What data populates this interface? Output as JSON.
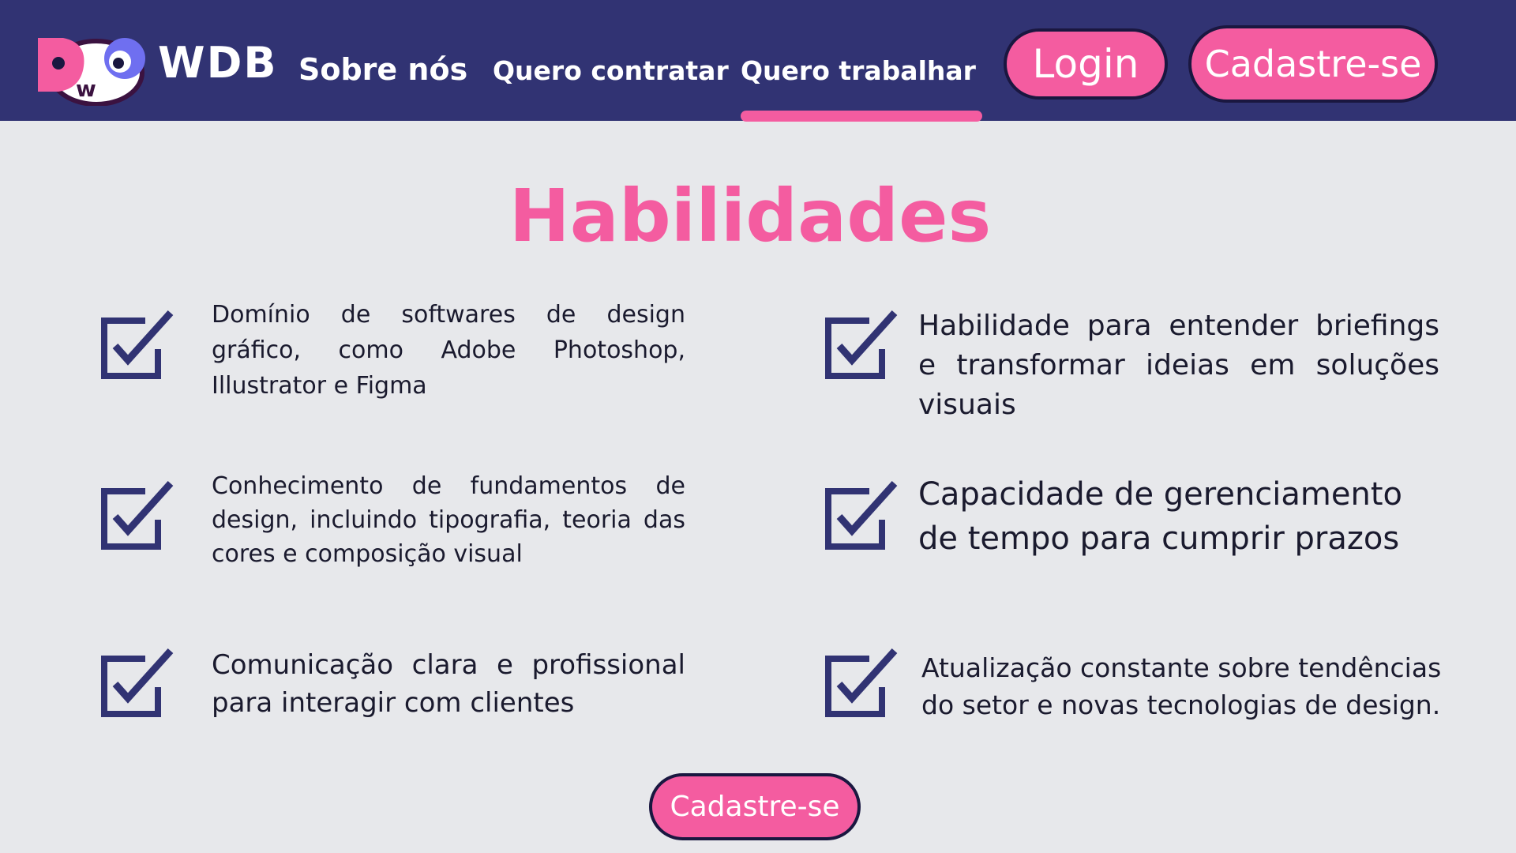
{
  "header": {
    "brand": "WDB",
    "logo_icon": "dwo-face-logo",
    "nav": {
      "about": "Sobre nós",
      "hire": "Quero contratar",
      "work": "Quero trabalhar",
      "active": "Quero trabalhar"
    },
    "login_label": "Login",
    "signup_label": "Cadastre-se"
  },
  "main": {
    "title": "Habilidades",
    "check_icon": "checkbox-checked-icon",
    "skills": [
      "Domínio de softwares de design gráfico, como Adobe Photoshop, Illustrator e Figma",
      "Conhecimento de fundamentos de design, incluindo tipografia, teoria das cores e composição visual",
      "Comunicação clara e profissional para interagir com clientes",
      "Habilidade para entender briefings e transformar ideias em soluções visuais",
      "Capacidade de gerenciamento de tempo para cumprir prazos",
      "Atualização constante sobre tendências do setor e novas tecnologias de design."
    ],
    "signup_label": "Cadastre-se"
  },
  "colors": {
    "header_bg": "#313373",
    "accent_pink": "#f45ca0",
    "page_bg": "#e7e8eb",
    "check_navy": "#313373"
  }
}
